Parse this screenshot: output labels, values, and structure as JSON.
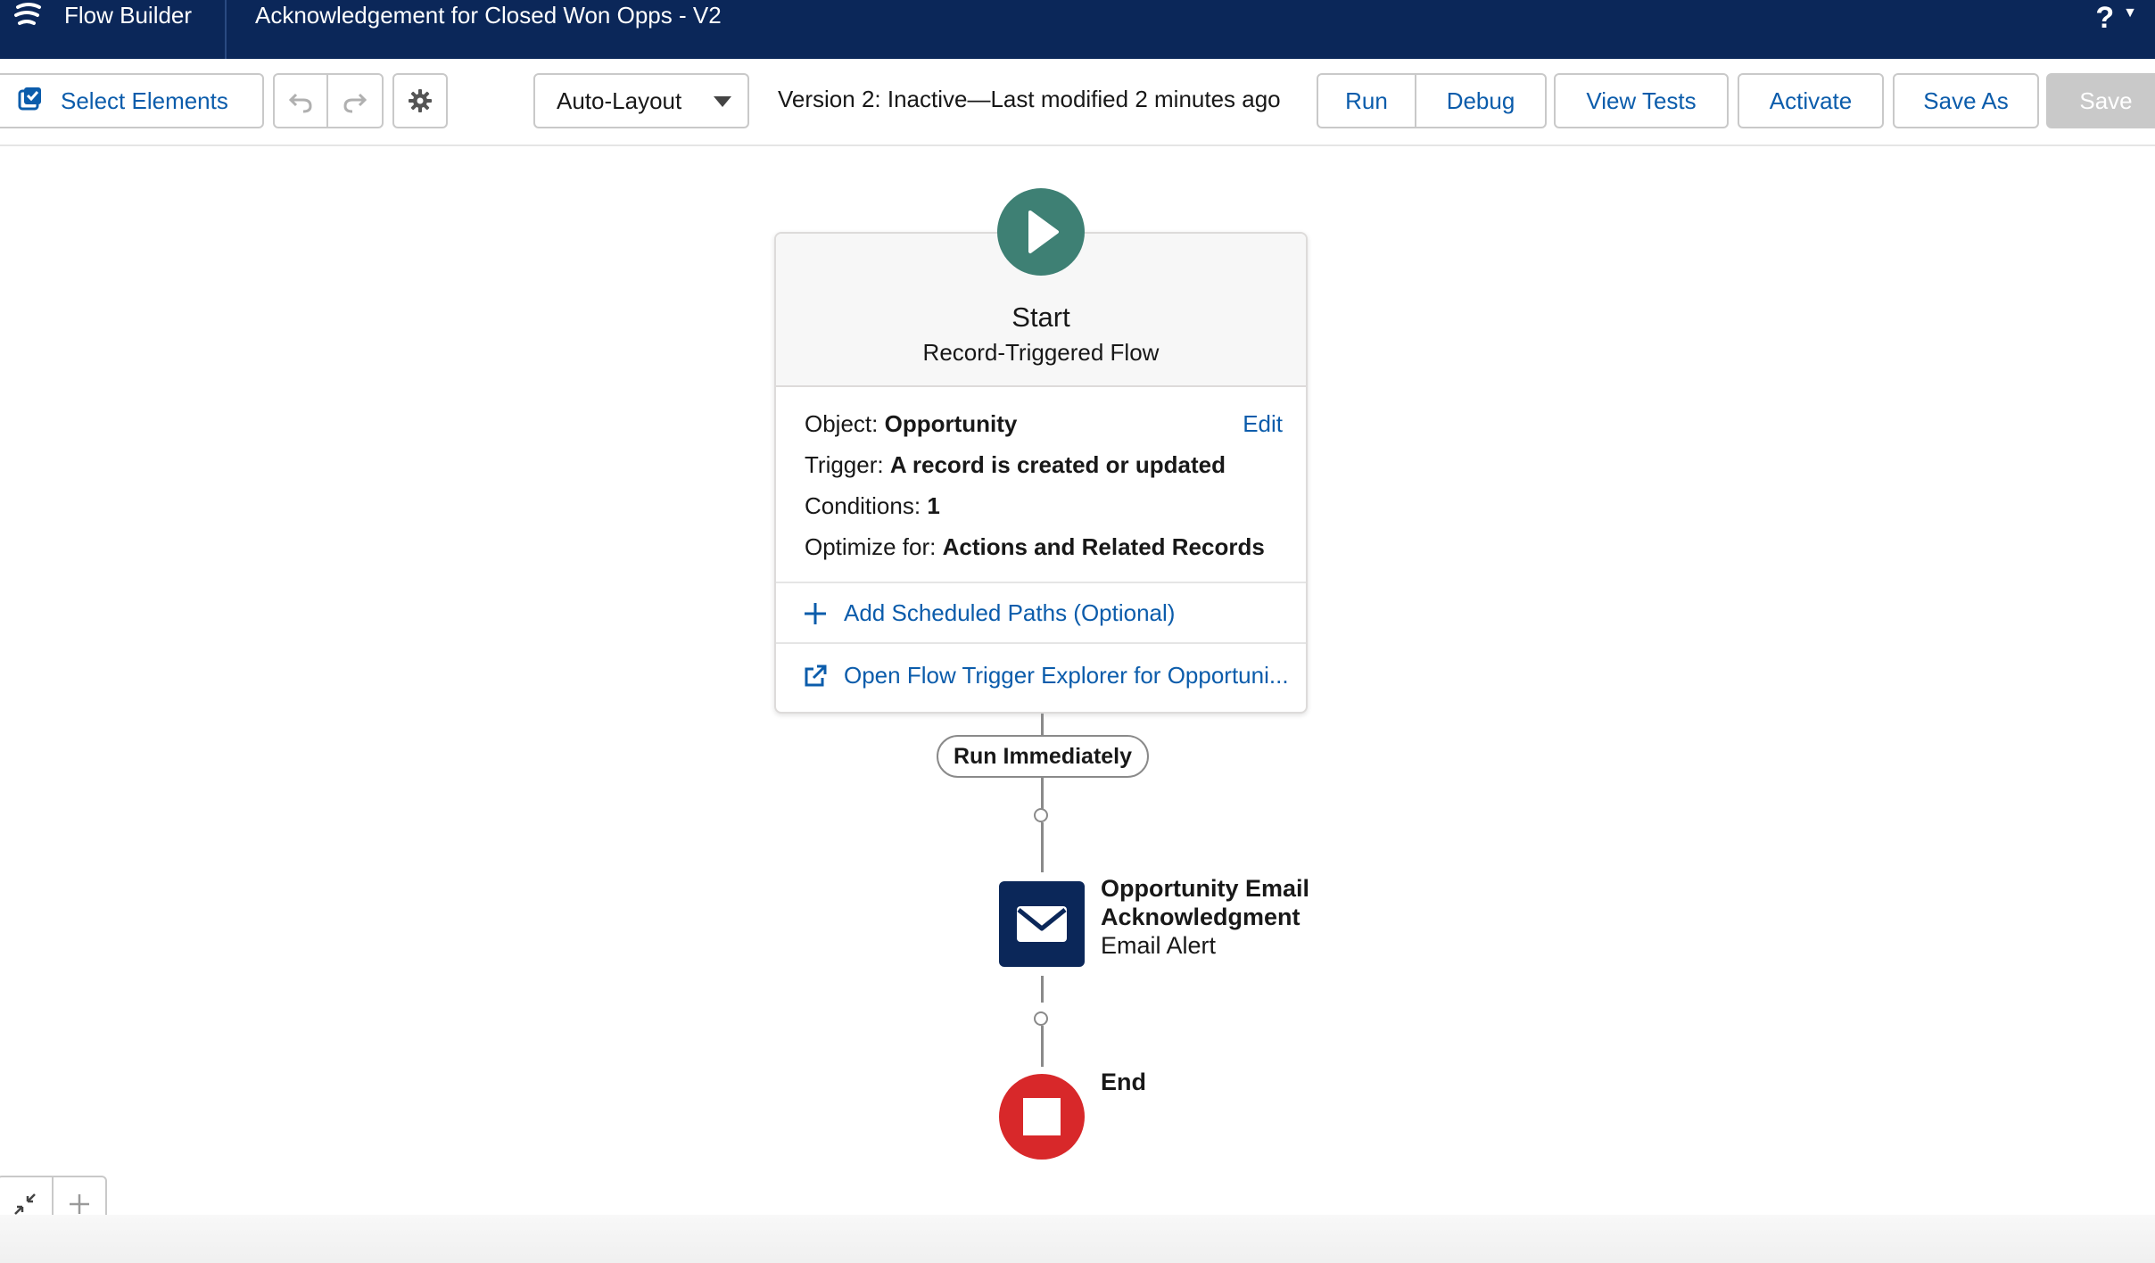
{
  "header": {
    "app_name": "Flow Builder",
    "flow_title": "Acknowledgement for Closed Won Opps - V2",
    "help_label": "?",
    "icons": {
      "logo": "flow-builder-logo-icon",
      "help": "question-icon"
    }
  },
  "toolbar": {
    "select_elements_label": "Select Elements",
    "layout_selected": "Auto-Layout",
    "version_status": "Version 2: Inactive—Last modified 2 minutes ago",
    "run_label": "Run",
    "debug_label": "Debug",
    "view_tests_label": "View Tests",
    "activate_label": "Activate",
    "save_as_label": "Save As",
    "save_label": "Save",
    "icons": {
      "select": "checkbox-icon",
      "undo": "undo-icon",
      "redo": "redo-icon",
      "settings": "gear-icon"
    }
  },
  "start": {
    "title": "Start",
    "subtitle": "Record-Triggered Flow",
    "object_label": "Object:",
    "object_value": "Opportunity",
    "edit_label": "Edit",
    "trigger_label": "Trigger:",
    "trigger_value": "A record is created or updated",
    "conditions_label": "Conditions:",
    "conditions_value": "1",
    "optimize_label": "Optimize for:",
    "optimize_value": "Actions and Related Records",
    "add_paths_label": "Add Scheduled Paths (Optional)",
    "open_explorer_label": "Open Flow Trigger Explorer for Opportuni..."
  },
  "path": {
    "label": "Run Immediately"
  },
  "element": {
    "name": "Opportunity Email Acknowledgment",
    "type": "Email Alert",
    "icon": "envelope-icon"
  },
  "end": {
    "label": "End"
  },
  "colors": {
    "header_bg": "#0b2759",
    "link": "#0b5cab",
    "start_green": "#3e8074",
    "end_red": "#d8282a",
    "save_disabled": "#c9c9c9"
  }
}
